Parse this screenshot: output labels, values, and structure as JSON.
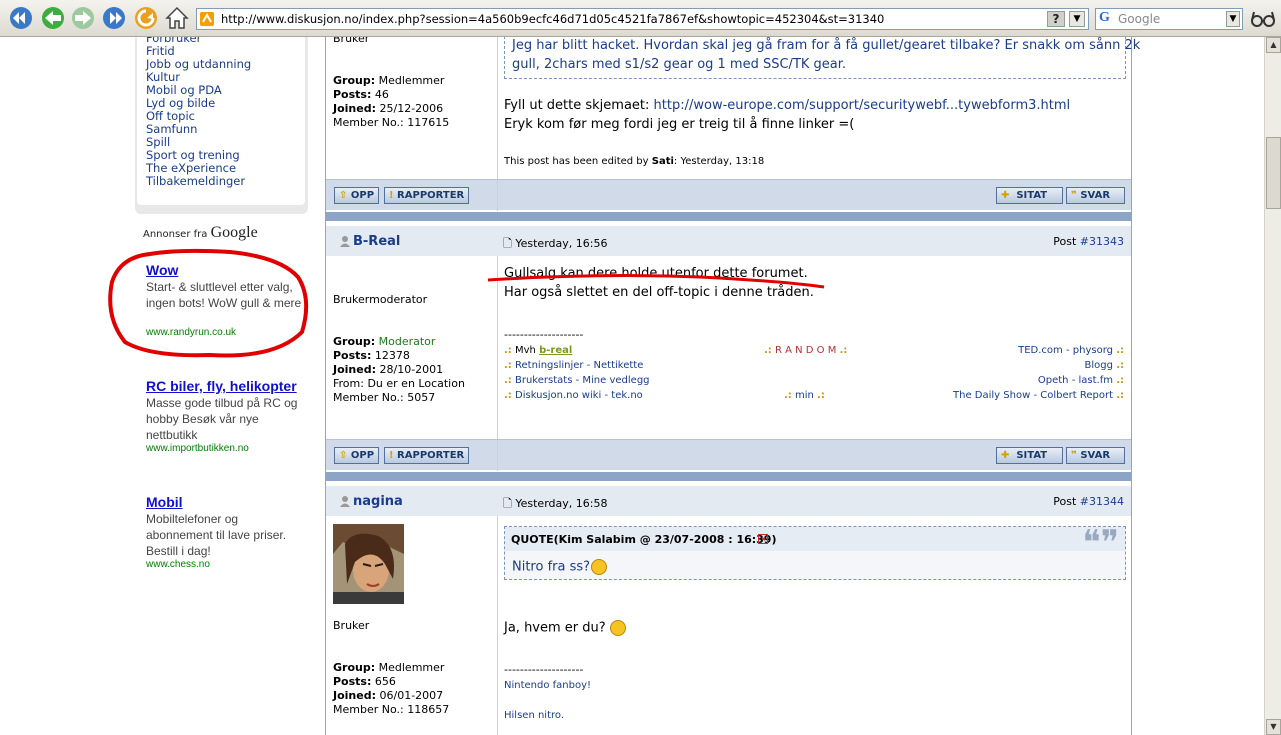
{
  "browser": {
    "url": "http://www.diskusjon.no/index.php?session=4a560b9ecfc46d71d05c4521fa7867ef&showtopic=452304&st=31340",
    "help": "?",
    "search_placeholder": "Google",
    "search_g": "G"
  },
  "sidebar": {
    "categories": [
      "Forbruker",
      "Fritid",
      "Jobb og utdanning",
      "Kultur",
      "Mobil og PDA",
      "Lyd og bilde",
      "Off topic",
      "Samfunn",
      "Spill",
      "Sport og trening",
      "The eXperience",
      "Tilbakemeldinger"
    ],
    "ads_label": "Annonser fra",
    "ads_brand": "Google",
    "ads": [
      {
        "title": "Wow",
        "text": "Start- & sluttlevel etter valg, ingen bots! WoW gull & mere",
        "url": "www.randyrun.co.uk"
      },
      {
        "title": "RC biler, fly, helikopter",
        "text": "Masse gode tilbud på RC og hobby Besøk vår nye nettbutikk",
        "url": "www.importbutikken.no"
      },
      {
        "title": "Mobil",
        "text": "Mobiltelefoner og abonnement til lave priser. Bestill i dag!",
        "url": "www.chess.no"
      }
    ]
  },
  "post1": {
    "role": "Bruker",
    "group_label": "Group:",
    "group": "Medlemmer",
    "posts_label": "Posts:",
    "posts": "46",
    "joined_label": "Joined:",
    "joined": "25/12-2006",
    "member_label": "Member No.:",
    "member": "117615",
    "quote_line1": "Jeg har blitt hacket. Hvordan skal jeg gå fram for å få gullet/gearet tilbake? Er snakk om sånn 2k",
    "quote_line2": "gull, 2chars med s1/s2 gear og 1 med SSC/TK gear.",
    "line1_prefix": "Fyll ut dette skjemaet:",
    "line1_link": "http://wow-europe.com/support/securitywebf...tywebform3.html",
    "line2": "Eryk kom før meg fordi jeg er treig til å finne linker =(",
    "edited_prefix": "This post has been edited by",
    "edited_by": "Sati",
    "edited_when": ": Yesterday, 13:18"
  },
  "actions": {
    "up": "OPP",
    "report": "RAPPORTER",
    "quote": "SITAT",
    "reply": "SVAR"
  },
  "post2": {
    "author": "B-Real",
    "date": "Yesterday, 16:56",
    "post_label": "Post",
    "post_num": "#31343",
    "role": "Brukermoderator",
    "group_label": "Group:",
    "group": "Moderator",
    "posts_label": "Posts:",
    "posts": "12378",
    "joined_label": "Joined:",
    "joined": "28/10-2001",
    "from": "From: Du er en Location",
    "member_label": "Member No.:",
    "member": "5057",
    "line1": "Gullsalg kan dere holde utenfor dette forumet.",
    "line2": "Har også slettet en del off-topic i denne tråden.",
    "sig_rule": "--------------------",
    "sig": {
      "mvh": "Mvh",
      "breal": "b-real",
      "random": "R A N D O M",
      "ted": "TED.com",
      "dash": "-",
      "physorg": "physorg",
      "retning": "Retningslinjer",
      "nettikette": "Nettikette",
      "blogg": "Blogg",
      "brukerstats": "Brukerstats",
      "vedlegg": "Mine vedlegg",
      "opeth": "Opeth",
      "lastfm": "last.fm",
      "wiki": "Diskusjon.no wiki",
      "tek": "tek.no",
      "min": "min",
      "daily": "The Daily Show",
      "colbert": "Colbert Report"
    }
  },
  "post3": {
    "author": "nagina",
    "date": "Yesterday, 16:58",
    "post_label": "Post",
    "post_num": "#31344",
    "role": "Bruker",
    "group_label": "Group:",
    "group": "Medlemmer",
    "posts_label": "Posts:",
    "posts": "656",
    "joined_label": "Joined:",
    "joined": "06/01-2007",
    "member_label": "Member No.:",
    "member": "118657",
    "quote_header": "QUOTE(Kim Salabim @ 23/07-2008 : 16:39)",
    "quote_text": "Nitro fra ss?",
    "reply": "Ja, hvem er du?",
    "sig_rule": "--------------------",
    "sig1": "Nintendo fanboy!",
    "sig2": "Hilsen nitro."
  },
  "colors": {
    "link": "#1a3c8c",
    "ad_title": "#1111cc",
    "ad_url": "#008000",
    "annotation": "#e00000",
    "bar": "#8ca4c6"
  }
}
